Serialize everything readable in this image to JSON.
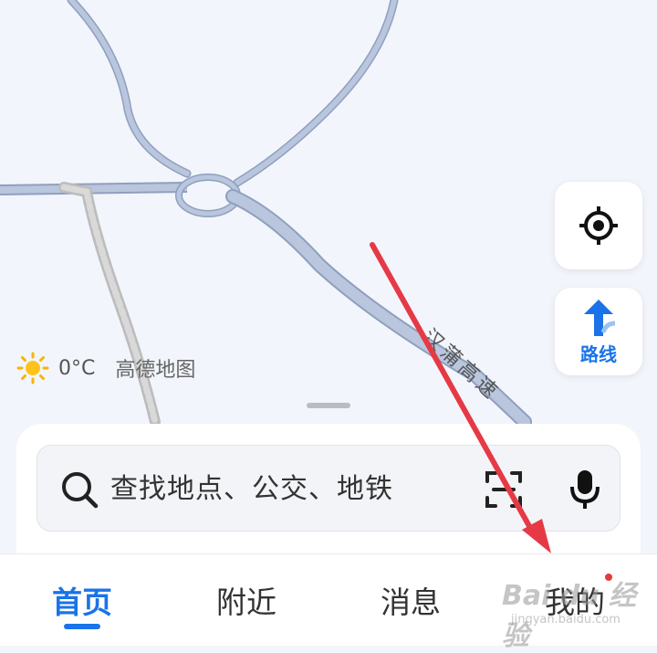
{
  "map": {
    "road_label": "汉蒲高速",
    "weather": {
      "icon": "sun-icon",
      "temperature": "0°C"
    },
    "brand": "高德地图"
  },
  "map_controls": {
    "locate": {
      "icon": "locate-target-icon"
    },
    "route": {
      "icon": "route-arrow-icon",
      "label": "路线"
    }
  },
  "search": {
    "placeholder": "查找地点、公交、地铁",
    "scan_icon": "scan-icon",
    "voice_icon": "microphone-icon"
  },
  "tabs": [
    {
      "label": "首页",
      "active": true
    },
    {
      "label": "附近",
      "active": false
    },
    {
      "label": "消息",
      "active": false
    },
    {
      "label": "我的",
      "active": false,
      "badge_dot": true
    }
  ],
  "annotation": {
    "arrow_color": "#e63946"
  },
  "watermark": {
    "main": "Bai du 经验",
    "sub": "jingyan.baidu.com"
  },
  "colors": {
    "accent": "#1a73e8",
    "badge": "#e53a3a",
    "road": "#b6c4dc",
    "map_bg": "#f2f5fb"
  }
}
